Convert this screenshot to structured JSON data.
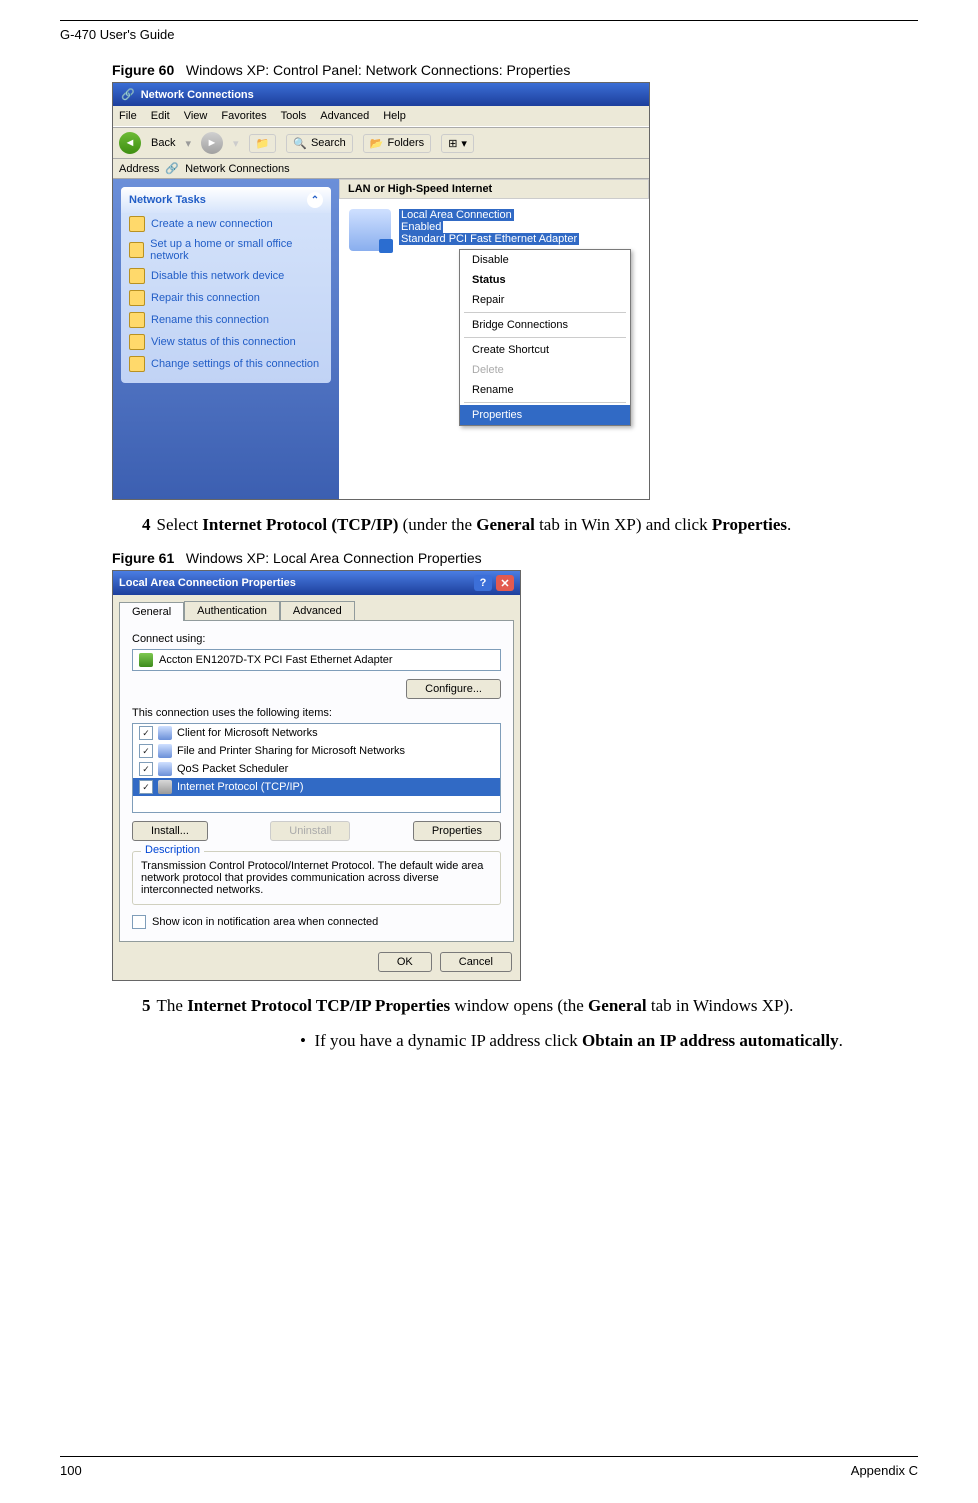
{
  "doc_header_left": "G-470 User's Guide",
  "footer_left": "100",
  "footer_right": "Appendix C",
  "figure60": {
    "caption_prefix": "Figure 60",
    "caption_text": "Windows XP: Control Panel: Network Connections: Properties",
    "title": "Network Connections",
    "menus": [
      "File",
      "Edit",
      "View",
      "Favorites",
      "Tools",
      "Advanced",
      "Help"
    ],
    "toolbar": {
      "back": "Back",
      "search": "Search",
      "folders": "Folders"
    },
    "address_label": "Address",
    "address_value": "Network Connections",
    "side_panel_title": "Network Tasks",
    "tasks": [
      "Create a new connection",
      "Set up a home or small office network",
      "Disable this network device",
      "Repair this connection",
      "Rename this connection",
      "View status of this connection",
      "Change settings of this connection"
    ],
    "section": "LAN or High-Speed Internet",
    "conn_name": "Local Area Connection",
    "conn_status": "Enabled",
    "conn_device": "Standard PCI Fast Ethernet Adapter",
    "context": {
      "disable": "Disable",
      "status": "Status",
      "repair": "Repair",
      "bridge": "Bridge Connections",
      "shortcut": "Create Shortcut",
      "delete": "Delete",
      "rename": "Rename",
      "properties": "Properties"
    }
  },
  "step4_num": "4",
  "step4_text_a": "Select ",
  "step4_bold_a": "Internet Protocol (TCP/IP)",
  "step4_text_b": " (under the ",
  "step4_bold_b": "General",
  "step4_text_c": " tab in Win XP) and click ",
  "step4_bold_c": "Properties",
  "step4_text_d": ".",
  "figure61": {
    "caption_prefix": "Figure 61",
    "caption_text": "Windows XP: Local Area Connection Properties",
    "title": "Local Area Connection Properties",
    "tabs": [
      "General",
      "Authentication",
      "Advanced"
    ],
    "connect_using": "Connect using:",
    "adapter": "Accton EN1207D-TX PCI Fast Ethernet Adapter",
    "configure_btn": "Configure...",
    "items_label": "This connection uses the following items:",
    "items": [
      "Client for Microsoft Networks",
      "File and Printer Sharing for Microsoft Networks",
      "QoS Packet Scheduler",
      "Internet Protocol (TCP/IP)"
    ],
    "install_btn": "Install...",
    "uninstall_btn": "Uninstall",
    "properties_btn": "Properties",
    "desc_label": "Description",
    "desc_text": "Transmission Control Protocol/Internet Protocol. The default wide area network protocol that provides communication across diverse interconnected networks.",
    "show_icon": "Show icon in notification area when connected",
    "ok": "OK",
    "cancel": "Cancel"
  },
  "step5_num": "5",
  "step5_text_a": "The ",
  "step5_bold_a": "Internet Protocol TCP/IP Properties",
  "step5_text_b": " window opens (the ",
  "step5_bold_b": "General",
  "step5_text_c": " tab in Windows XP).",
  "bullet_a": "If you have a dynamic IP address click ",
  "bullet_bold": "Obtain an IP address automatically",
  "bullet_b": "."
}
